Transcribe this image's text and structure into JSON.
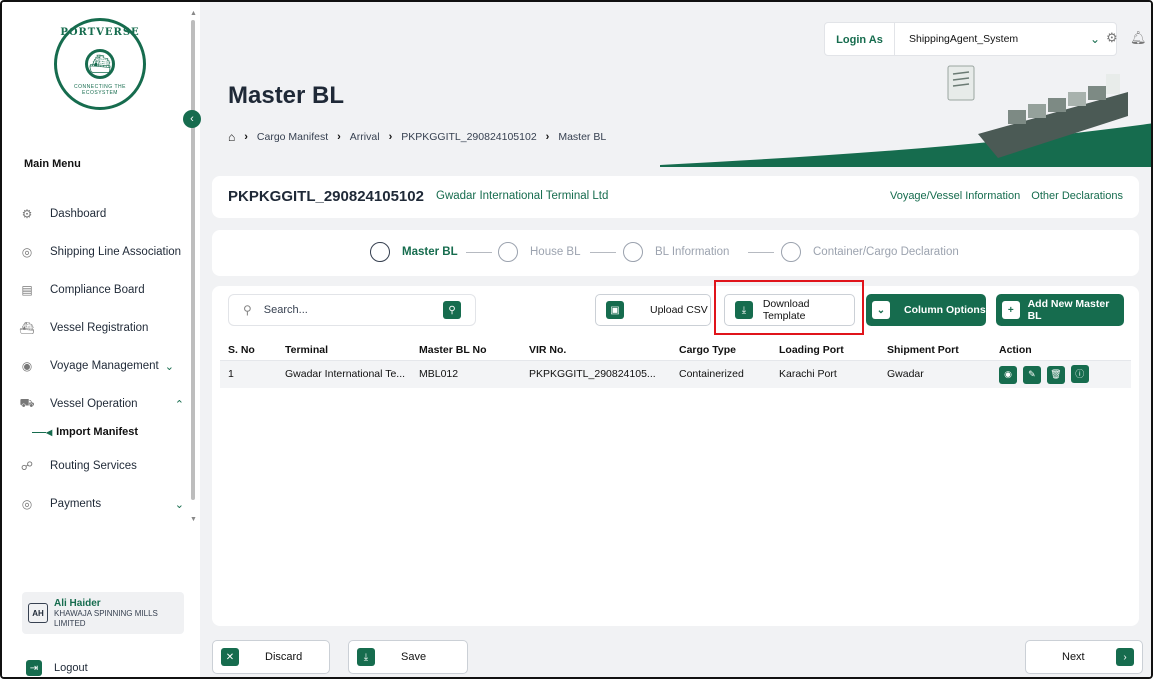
{
  "app": {
    "logo_text": "PORTVERSE",
    "logo_tagline": "CONNECTING THE ECOSYSTEM"
  },
  "sidebar": {
    "main_menu_label": "Main Menu",
    "items": [
      {
        "label": "Dashboard",
        "icon": "dashboard-icon"
      },
      {
        "label": "Shipping Line Association",
        "icon": "association-icon"
      },
      {
        "label": "Compliance Board",
        "icon": "document-icon"
      },
      {
        "label": "Vessel Registration",
        "icon": "ship-icon"
      },
      {
        "label": "Voyage Management",
        "icon": "voyage-icon",
        "expanded": false
      },
      {
        "label": "Vessel Operation",
        "icon": "vessel-operation-icon",
        "expanded": true
      }
    ],
    "subitem_active": "Import Manifest",
    "items_after": [
      {
        "label": "Routing Services",
        "icon": "routing-icon"
      },
      {
        "label": "Payments",
        "icon": "payments-icon",
        "expanded": false
      }
    ],
    "user": {
      "initials": "AH",
      "name": "Ali Haider",
      "org": "KHAWAJA SPINNING MILLS LIMITED"
    },
    "logout_label": "Logout"
  },
  "header": {
    "login_as_label": "Login As",
    "login_user": "ShippingAgent_System",
    "page_title": "Master BL",
    "breadcrumb": [
      "Cargo Manifest",
      "Arrival",
      "PKPKGGITL_290824105102",
      "Master BL"
    ]
  },
  "declaration": {
    "id": "PKPKGGITL_290824105102",
    "terminal": "Gwadar International Terminal Ltd",
    "links": [
      "Voyage/Vessel Information",
      "Other Declarations"
    ]
  },
  "stepper": {
    "steps": [
      {
        "label": "Master BL",
        "active": true
      },
      {
        "label": "House BL",
        "active": false
      },
      {
        "label": "BL Information",
        "active": false
      },
      {
        "label": "Container/Cargo Declaration",
        "active": false
      }
    ]
  },
  "toolbar": {
    "search_placeholder": "Search...",
    "upload_csv": "Upload CSV",
    "download_template": "Download Template",
    "column_options": "Column Options",
    "add_new": "Add New Master BL"
  },
  "table": {
    "columns": [
      "S. No",
      "Terminal",
      "Master BL No",
      "VIR No.",
      "Cargo Type",
      "Loading Port",
      "Shipment Port",
      "Action"
    ],
    "rows": [
      [
        "1",
        "Gwadar International Te...",
        "MBL012",
        "PKPKGGITL_290824105...",
        "Containerized",
        "Karachi Port",
        "Gwadar"
      ]
    ],
    "actions": [
      "view-icon",
      "edit-icon",
      "delete-icon",
      "info-icon"
    ]
  },
  "footer": {
    "discard": "Discard",
    "save": "Save",
    "next": "Next"
  },
  "colors": {
    "brand": "#166c4e",
    "highlight": "#e0141b",
    "background": "#f1f2f4"
  }
}
